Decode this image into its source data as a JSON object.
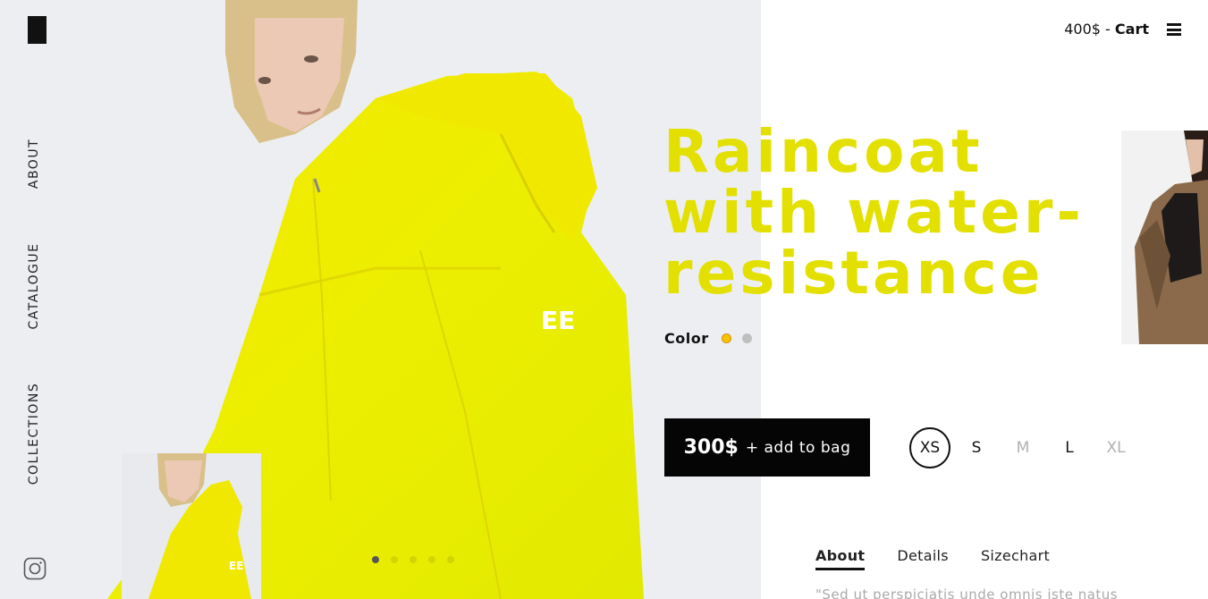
{
  "header": {
    "cart_amount": "400$",
    "cart_separator": " - ",
    "cart_label": "Cart",
    "menu_icon": "hamburger-menu-icon"
  },
  "side_nav": {
    "items": [
      {
        "label": "ABOUT"
      },
      {
        "label": "CATALOGUE"
      },
      {
        "label": "COLLECTIONS"
      }
    ],
    "social_icon": "instagram-icon"
  },
  "product": {
    "title_line1": "Raincoat",
    "title_line2": "with water-",
    "title_line3": "resistance",
    "color_label": "Color",
    "colors": [
      "#f5c400",
      "#bfbfbf"
    ],
    "price": "300$",
    "add_label": "+ add to bag",
    "sizes": [
      {
        "label": "XS",
        "state": "selected"
      },
      {
        "label": "S",
        "state": "available"
      },
      {
        "label": "M",
        "state": "disabled"
      },
      {
        "label": "L",
        "state": "available"
      },
      {
        "label": "XL",
        "state": "disabled"
      }
    ],
    "accent_color": "#e3e000"
  },
  "tabs": [
    {
      "label": "About",
      "active": true
    },
    {
      "label": "Details",
      "active": false
    },
    {
      "label": "Sizechart",
      "active": false
    }
  ],
  "description": "\"Sed ut perspiciatis unde omnis iste natus",
  "slider": {
    "active_index": 0,
    "count": 5
  }
}
